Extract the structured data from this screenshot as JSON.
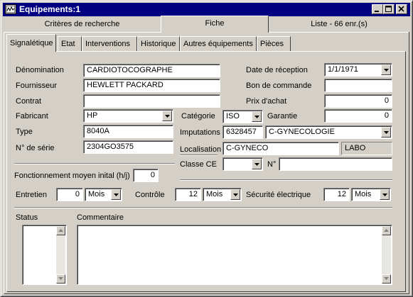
{
  "window": {
    "title": "Equipements:1"
  },
  "outer_tabs": [
    {
      "label": "Critères de recherche"
    },
    {
      "label": "Fiche"
    },
    {
      "label": "Liste - 66 enr.(s)"
    }
  ],
  "inner_tabs": [
    {
      "label": "Signalétique"
    },
    {
      "label": "Etat"
    },
    {
      "label": "Interventions"
    },
    {
      "label": "Historique"
    },
    {
      "label": "Autres équipements"
    },
    {
      "label": "Pièces"
    }
  ],
  "form": {
    "denomination": {
      "label": "Dénomination",
      "value": "CARDIOTOCOGRAPHE"
    },
    "fournisseur": {
      "label": "Fournisseur",
      "value": "HEWLETT PACKARD"
    },
    "contrat": {
      "label": "Contrat",
      "value": ""
    },
    "fabricant": {
      "label": "Fabricant",
      "value": "HP"
    },
    "type": {
      "label": "Type",
      "value": "8040A"
    },
    "numero_serie": {
      "label": "N° de série",
      "value": "2304GO3575"
    },
    "date_reception": {
      "label": "Date de réception",
      "value": "1/1/1971"
    },
    "bon_commande": {
      "label": "Bon de commande",
      "value": ""
    },
    "prix_achat": {
      "label": "Prix d'achat",
      "value": "0"
    },
    "categorie": {
      "label": "Catégorie",
      "value": "ISO"
    },
    "garantie": {
      "label": "Garantie",
      "value": "0"
    },
    "imputations": {
      "label": "Imputations",
      "code": "6328457",
      "value": "C-GYNECOLOGIE"
    },
    "localisation": {
      "label": "Localisation",
      "value": "C-GYNECO",
      "extra": "LABO"
    },
    "classe_ce": {
      "label": "Classe CE",
      "value": "",
      "num_label": "N°",
      "num_value": ""
    },
    "fonctionnement": {
      "label": "Fonctionnement moyen inital (h/j)",
      "value": "0"
    },
    "entretien": {
      "label": "Entretien",
      "value": "0",
      "unit": "Mois"
    },
    "controle": {
      "label": "Contrôle",
      "value": "12",
      "unit": "Mois"
    },
    "securite": {
      "label": "Sécurité électrique",
      "value": "12",
      "unit": "Mois"
    },
    "status": {
      "label": "Status"
    },
    "commentaire": {
      "label": "Commentaire",
      "value": ""
    }
  },
  "colors": {
    "titlebar": "#000080",
    "face": "#d4d0c8"
  }
}
